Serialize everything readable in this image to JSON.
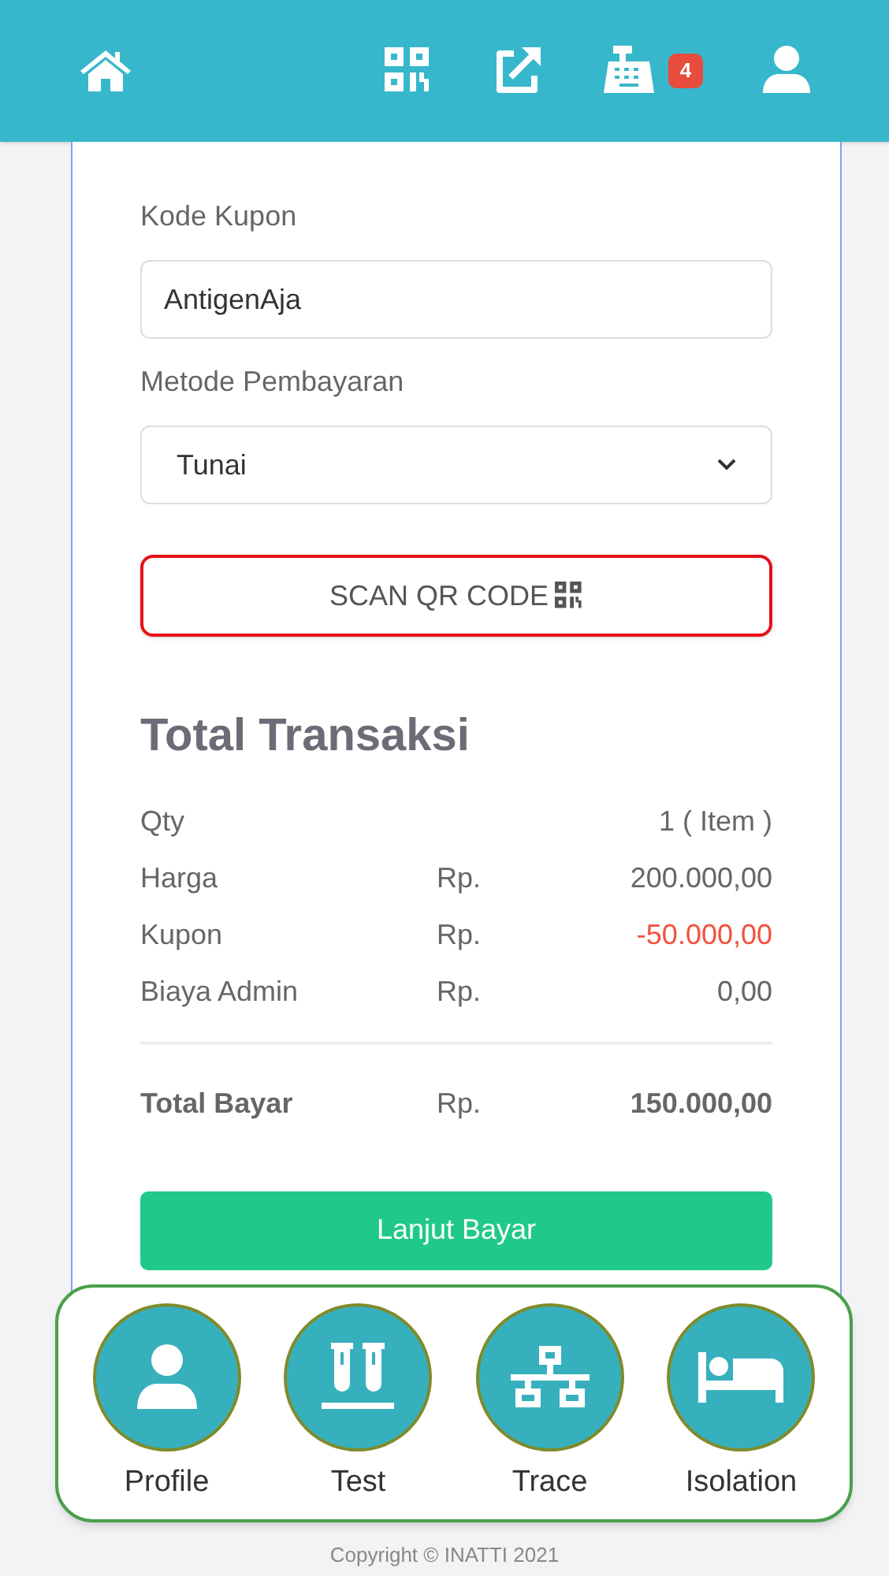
{
  "header": {
    "cart_badge": "4"
  },
  "form": {
    "coupon_label": "Kode Kupon",
    "coupon_value": "AntigenAja",
    "payment_label": "Metode Pembayaran",
    "payment_value": "Tunai",
    "scan_button": "SCAN QR CODE"
  },
  "summary": {
    "title": "Total Transaksi",
    "rows": [
      {
        "label": "Qty",
        "value": "1 ( Item )",
        "negative": false
      },
      {
        "label": "Harga",
        "currency": "Rp.",
        "value": "200.000,00",
        "negative": false
      },
      {
        "label": "Kupon",
        "currency": "Rp.",
        "value": "-50.000,00",
        "negative": true
      },
      {
        "label": "Biaya Admin",
        "currency": "Rp.",
        "value": "0,00",
        "negative": false
      }
    ],
    "total": {
      "label": "Total Bayar",
      "currency": "Rp.",
      "value": "150.000,00"
    },
    "pay_button": "Lanjut Bayar"
  },
  "bottom_nav": [
    {
      "kind": "profile",
      "label": "Profile"
    },
    {
      "kind": "test",
      "label": "Test"
    },
    {
      "kind": "trace",
      "label": "Trace"
    },
    {
      "kind": "isolation",
      "label": "Isolation"
    }
  ],
  "copyright": "Copyright © INATTI 2021"
}
